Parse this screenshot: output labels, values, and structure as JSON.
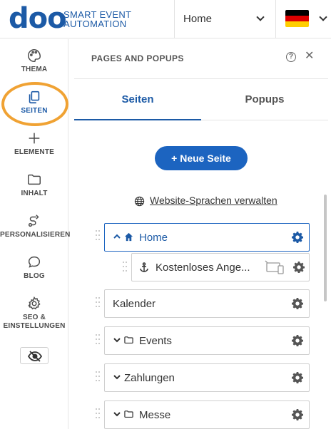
{
  "brand": {
    "logo_word": "doo",
    "logo_line1": "SMART EVENT",
    "logo_line2": "AUTOMATION"
  },
  "header": {
    "page_select_value": "Home",
    "language_flag": "german-flag"
  },
  "sidebar": {
    "items": [
      {
        "label": "THEMA",
        "icon": "palette-icon"
      },
      {
        "label": "SEITEN",
        "icon": "pages-icon"
      },
      {
        "label": "ELEMENTE",
        "icon": "plus-icon"
      },
      {
        "label": "INHALT",
        "icon": "folder-icon"
      },
      {
        "label": "PERSONALISIEREN",
        "icon": "route-icon"
      },
      {
        "label": "BLOG",
        "icon": "chat-bubble-icon"
      },
      {
        "label": "SEO &",
        "label2": "EINSTELLUNGEN",
        "icon": "gear-icon"
      }
    ],
    "preview_icon": "eye-icon",
    "accent_color": "#1c5aa6",
    "highlight_color": "#f0a233"
  },
  "panel": {
    "title": "PAGES AND POPUPS",
    "help": "?",
    "close": "✕",
    "tabs": [
      {
        "label": "Seiten"
      },
      {
        "label": "Popups"
      }
    ],
    "new_page_label": "+ Neue Seite",
    "manage_languages_label": "Website-Sprachen verwalten",
    "pages": [
      {
        "label": "Home",
        "prefix": "chevron-up-icon",
        "icon": "home-icon"
      },
      {
        "label": "Kostenloses Ange...",
        "icon": "anchor-icon",
        "device": "device-icon"
      },
      {
        "label": "Kalender"
      },
      {
        "label": "Events",
        "prefix": "chevron-down-icon",
        "icon": "folder-icon"
      },
      {
        "label": "Zahlungen",
        "prefix": "chevron-down-icon"
      },
      {
        "label": "Messe",
        "prefix": "chevron-down-icon",
        "icon": "folder-icon"
      }
    ]
  }
}
